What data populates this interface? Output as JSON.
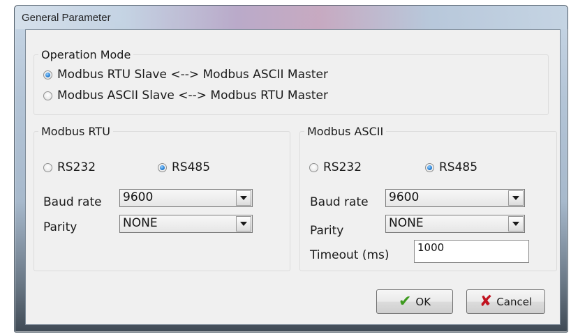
{
  "window": {
    "title": "General Parameter"
  },
  "operation_mode": {
    "legend": "Operation Mode",
    "options": [
      {
        "label": "Modbus RTU Slave <--> Modbus ASCII Master",
        "selected": true
      },
      {
        "label": "Modbus ASCII Slave <--> Modbus RTU Master",
        "selected": false
      }
    ]
  },
  "rtu": {
    "legend": "Modbus RTU",
    "rs232": "RS232",
    "rs485": "RS485",
    "baud_label": "Baud rate",
    "baud_value": "9600",
    "parity_label": "Parity",
    "parity_value": "NONE"
  },
  "ascii": {
    "legend": "Modbus ASCII",
    "rs232": "RS232",
    "rs485": "RS485",
    "baud_label": "Baud rate",
    "baud_value": "9600",
    "parity_label": "Parity",
    "parity_value": "NONE",
    "timeout_label": "Timeout (ms)",
    "timeout_value": "1000"
  },
  "buttons": {
    "ok": "OK",
    "cancel": "Cancel"
  },
  "icons": {
    "ok": "checkmark-icon",
    "cancel": "x-icon"
  },
  "colors": {
    "radio_selected": "#2a84d8",
    "ok_icon": "#3d9a1e",
    "cancel_icon": "#c1121f"
  }
}
